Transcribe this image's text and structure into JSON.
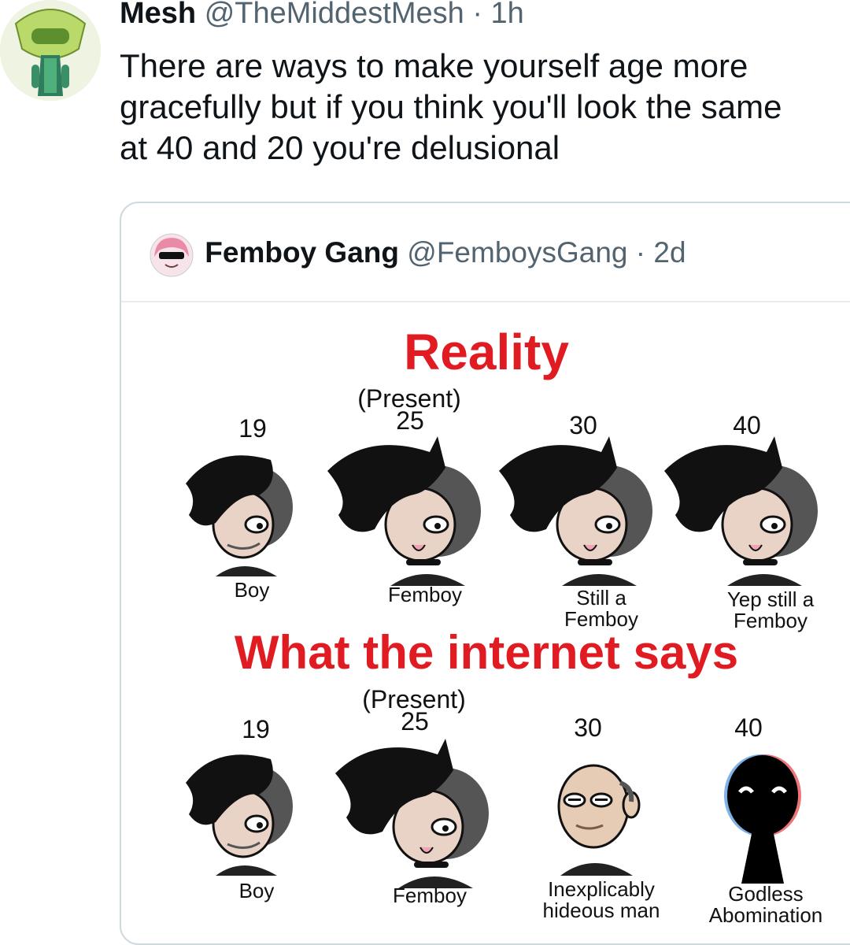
{
  "tweet": {
    "author_name": "Mesh",
    "author_handle": "@TheMiddestMesh",
    "separator": "·",
    "time": "1h",
    "text_lines": [
      "There are ways to make yourself age more",
      "gracefully but if you think you'll look the same",
      "at 40 and 20 you're delusional"
    ]
  },
  "quote": {
    "author_name": "Femboy Gang",
    "author_handle": "@FemboysGang",
    "separator": "·",
    "time": "2d",
    "meme": {
      "title_top": "Reality",
      "title_bottom": "What the internet says",
      "present_label": "(Present)",
      "top_row": [
        {
          "age": "19",
          "caption": "Boy"
        },
        {
          "age": "25",
          "caption": "Femboy"
        },
        {
          "age": "30",
          "caption_lines": [
            "Still a",
            "Femboy"
          ]
        },
        {
          "age": "40",
          "caption_lines": [
            "Yep still a",
            "Femboy"
          ]
        }
      ],
      "bottom_row": [
        {
          "age": "19",
          "caption": "Boy"
        },
        {
          "age": "25",
          "caption": "Femboy"
        },
        {
          "age": "30",
          "caption_lines": [
            "Inexplicably",
            "hideous man"
          ]
        },
        {
          "age": "40",
          "caption_lines": [
            "Godless",
            "Abomination"
          ]
        }
      ]
    }
  },
  "icons": {
    "main_avatar": "peridot-figure-avatar-icon",
    "quote_avatar": "sunglasses-girl-avatar-icon"
  }
}
